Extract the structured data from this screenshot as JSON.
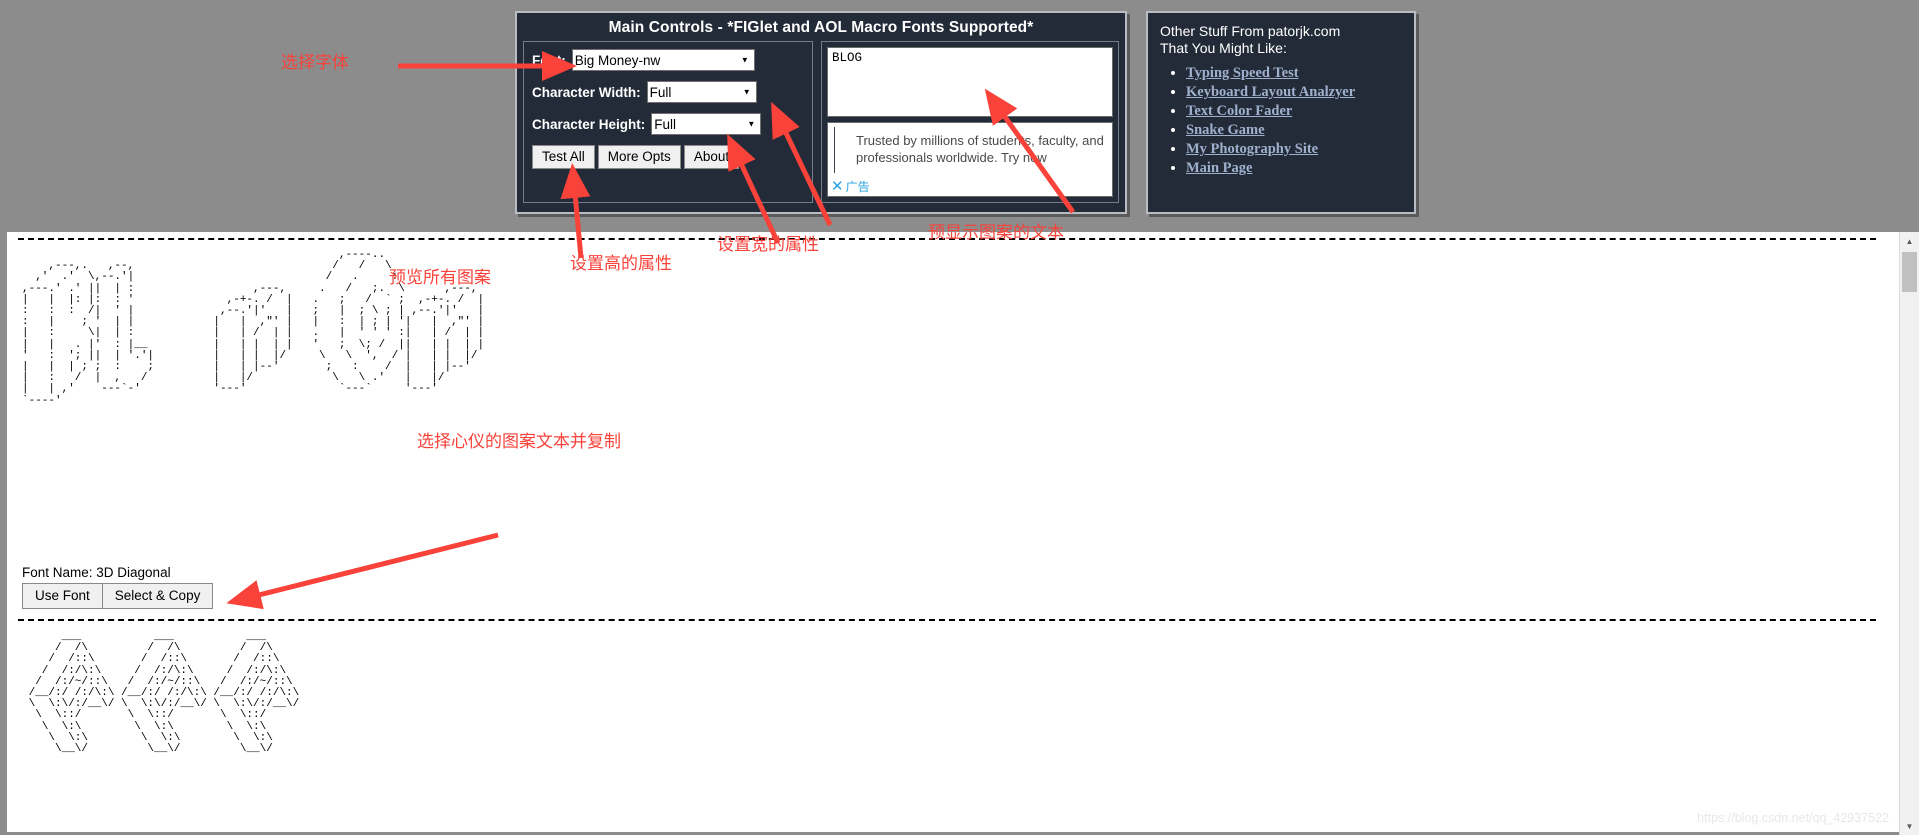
{
  "main_controls": {
    "title": "Main Controls - *FIGlet and AOL Macro Fonts Supported*",
    "font_label": "Font:",
    "font_value": "Big Money-nw",
    "char_width_label": "Character Width:",
    "char_width_value": "Full",
    "char_height_label": "Character Height:",
    "char_height_value": "Full",
    "buttons": {
      "test_all": "Test All",
      "more_opts": "More Opts",
      "about": "About"
    },
    "preview_input_value": "BLOG",
    "ad": {
      "text": "Trusted by millions of students, faculty, and professionals worldwide. Try now",
      "close_icon": "✕",
      "label": "广告"
    }
  },
  "other_stuff": {
    "heading_line1": "Other Stuff From patorjk.com",
    "heading_line2": "That You Might Like:",
    "links": [
      "Typing Speed Test",
      "Keyboard Layout Analzyer",
      "Text Color Fader",
      "Snake Game",
      "My Photography Site",
      "Main Page"
    ]
  },
  "result": {
    "font_name_label": "Font Name: 3D Diagonal",
    "use_font_button": "Use Font",
    "select_copy_button": "Select & Copy",
    "ascii_art_1": "                                                ,----..                           \n    ,---,.   ,--,                              /   /   \\                          \n  ,'  .'  \\,--.'|                             /   .     :                        \n,---.' .' ||  | :                  ,---,     .   /   ;.  \\      ,---,            \n|   |  |: |:  : '              ,-+-. /  |   .   ;   /  ` ;  ,-+-. /  |           \n:   :  :  /|  ' |             ,--.'|'   |   ;   |  ; \\ ; | ,--.'|'   |           \n:   |    ; '  | |            |   |  ,\"' |   |   :  | ; | '|   |  ,\"' |           \n|   :     \\|  | :            |   | /  | |   .   |  ' ' ' :|   | /  | |           \n|   |   . |'  : |__          |   | |  | |   '   ;  \\; /  ||   | |  | |           \n'   :  '; ||  | '.'|         |   | |  |/     \\   \\  ',  / |   | |  |/            \n|   |  | ; ;  :    ;         |   | |--'       ;   :    /  |   | |--'             \n|   :   /  |  ,   /          |   |/            \\   \\ .'   |   |/                 \n|   | ,'    ---`-'           '---'              `---`     '---'                  \n`----'                                                                           ",
    "ascii_art_2": "      ___           ___           ___      \n     /  /\\         /  /\\         /  /\\     \n    /  /::\\       /  /::\\       /  /::\\    \n   /  /:/\\:\\     /  /:/\\:\\     /  /:/\\:\\   \n  /  /:/~/::\\   /  /:/~/::\\   /  /:/~/::\\  \n /__/:/ /:/\\:\\ /__/:/ /:/\\:\\ /__/:/ /:/\\:\\ \n \\  \\:\\/:/__\\/ \\  \\:\\/:/__\\/ \\  \\:\\/:/__\\/ \n  \\  \\::/       \\  \\::/       \\  \\::/      \n   \\  \\:\\        \\  \\:\\        \\  \\:\\      \n    \\  \\:\\        \\  \\:\\        \\  \\:\\     \n     \\__\\/         \\__\\/         \\__\\/     "
  },
  "annotations": {
    "select_font": "选择字体",
    "preview_all": "预览所有图案",
    "set_height": "设置高的属性",
    "set_width": "设置宽的属性",
    "preview_text": "预显示图案的文本",
    "select_copy": "选择心仪的图案文本并复制"
  },
  "scrollbar": {
    "up_arrow": "▲",
    "down_arrow": "▼"
  },
  "watermark": "https://blog.csdn.net/qq_42937522",
  "colors": {
    "panel_bg": "#232b39",
    "panel_border": "#b9bcc2",
    "page_bg": "#8c8c8c",
    "annotation": "#f9423a",
    "link": "#9fb0cc"
  }
}
